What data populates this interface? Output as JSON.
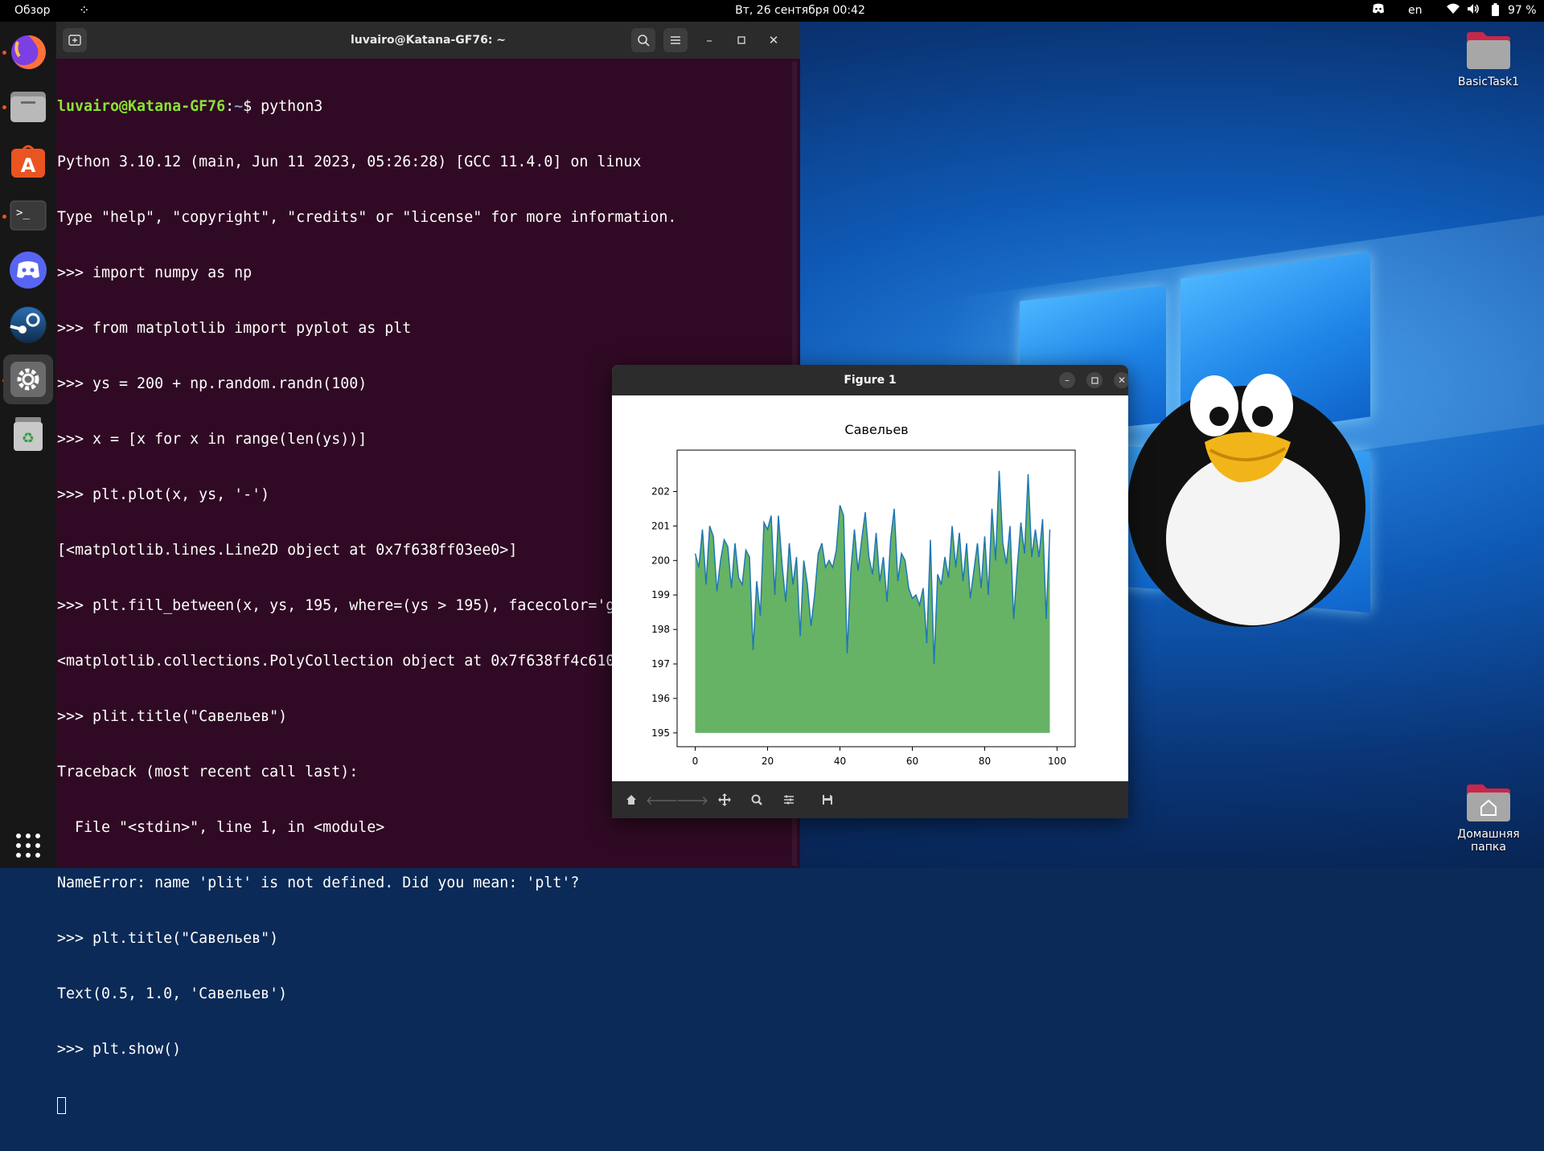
{
  "topbar": {
    "activities": "Обзор",
    "datetime": "Вт, 26 сентября  00:42",
    "lang": "en",
    "battery": "97 %"
  },
  "dock": {
    "items": [
      "firefox",
      "files",
      "app-center",
      "terminal",
      "discord",
      "steam",
      "settings",
      "trash",
      "show-apps"
    ]
  },
  "terminal": {
    "title": "luvairo@Katana-GF76: ~",
    "prompt_user": "luvairo@Katana-GF76",
    "prompt_sep": ":",
    "prompt_path": "~",
    "first_command": "$ python3",
    "lines": [
      "Python 3.10.12 (main, Jun 11 2023, 05:26:28) [GCC 11.4.0] on linux",
      "Type \"help\", \"copyright\", \"credits\" or \"license\" for more information.",
      ">>> import numpy as np",
      ">>> from matplotlib import pyplot as plt",
      ">>> ys = 200 + np.random.randn(100)",
      ">>> x = [x for x in range(len(ys))]",
      ">>> plt.plot(x, ys, '-')",
      "[<matplotlib.lines.Line2D object at 0x7f638ff03ee0>]",
      ">>> plt.fill_between(x, ys, 195, where=(ys > 195), facecolor='g', alpha=0.6)",
      "<matplotlib.collections.PolyCollection object at 0x7f638ff4c610>",
      ">>> plit.title(\"Савельев\")",
      "Traceback (most recent call last):",
      "  File \"<stdin>\", line 1, in <module>",
      "NameError: name 'plit' is not defined. Did you mean: 'plt'?",
      ">>> plt.title(\"Савельев\")",
      "Text(0.5, 1.0, 'Савельев')",
      ">>> plt.show()"
    ],
    "colors": {
      "background": "#300a24",
      "user": "#8ae234",
      "path": "#729fcf"
    }
  },
  "figure": {
    "title": "Figure 1",
    "toolbar": [
      "home-icon",
      "back-icon",
      "forward-icon",
      "pan-icon",
      "zoom-icon",
      "configure-icon",
      "save-icon"
    ]
  },
  "chart_data": {
    "type": "area",
    "title": "Савельев",
    "xlabel": "",
    "ylabel": "",
    "xlim": [
      -5,
      105
    ],
    "ylim": [
      194.6,
      203.2
    ],
    "xticks": [
      0,
      20,
      40,
      60,
      80,
      100
    ],
    "yticks": [
      195,
      196,
      197,
      198,
      199,
      200,
      201,
      202
    ],
    "baseline": 195,
    "line_color": "#1f77b4",
    "fill_color": "#008000",
    "fill_alpha": 0.6,
    "x": [
      0,
      1,
      2,
      3,
      4,
      5,
      6,
      7,
      8,
      9,
      10,
      11,
      12,
      13,
      14,
      15,
      16,
      17,
      18,
      19,
      20,
      21,
      22,
      23,
      24,
      25,
      26,
      27,
      28,
      29,
      30,
      31,
      32,
      33,
      34,
      35,
      36,
      37,
      38,
      39,
      40,
      41,
      42,
      43,
      44,
      45,
      46,
      47,
      48,
      49,
      50,
      51,
      52,
      53,
      54,
      55,
      56,
      57,
      58,
      59,
      60,
      61,
      62,
      63,
      64,
      65,
      66,
      67,
      68,
      69,
      70,
      71,
      72,
      73,
      74,
      75,
      76,
      77,
      78,
      79,
      80,
      81,
      82,
      83,
      84,
      85,
      86,
      87,
      88,
      89,
      90,
      91,
      92,
      93,
      94,
      95,
      96,
      97,
      98
    ],
    "y": [
      200.2,
      199.8,
      200.9,
      199.3,
      201.0,
      200.7,
      199.1,
      200.0,
      200.6,
      200.4,
      199.2,
      200.5,
      199.5,
      199.3,
      200.3,
      200.1,
      197.4,
      199.4,
      198.4,
      201.1,
      200.9,
      201.3,
      199.0,
      201.3,
      199.9,
      198.8,
      200.5,
      199.3,
      200.1,
      197.8,
      200.0,
      199.3,
      198.1,
      199.0,
      200.2,
      200.5,
      199.8,
      200.0,
      199.8,
      200.3,
      201.6,
      201.3,
      197.3,
      199.7,
      200.9,
      199.7,
      200.6,
      201.4,
      200.1,
      199.6,
      200.8,
      199.4,
      200.1,
      198.8,
      200.6,
      201.5,
      199.4,
      200.2,
      200.0,
      199.2,
      198.9,
      199.0,
      198.7,
      199.2,
      197.6,
      200.6,
      197.0,
      199.6,
      199.3,
      200.1,
      199.5,
      201.0,
      199.8,
      200.8,
      199.4,
      200.5,
      198.9,
      199.7,
      200.5,
      199.2,
      200.7,
      199.0,
      201.5,
      200.0,
      202.6,
      200.5,
      199.9,
      201.0,
      198.3,
      199.8,
      201.1,
      200.2,
      202.5,
      200.1,
      200.9,
      200.1,
      201.2,
      198.3,
      200.9,
      200.2
    ]
  },
  "desktop": {
    "icons": [
      {
        "label": "BasicTask1"
      },
      {
        "label": "Домашняя папка"
      }
    ]
  }
}
